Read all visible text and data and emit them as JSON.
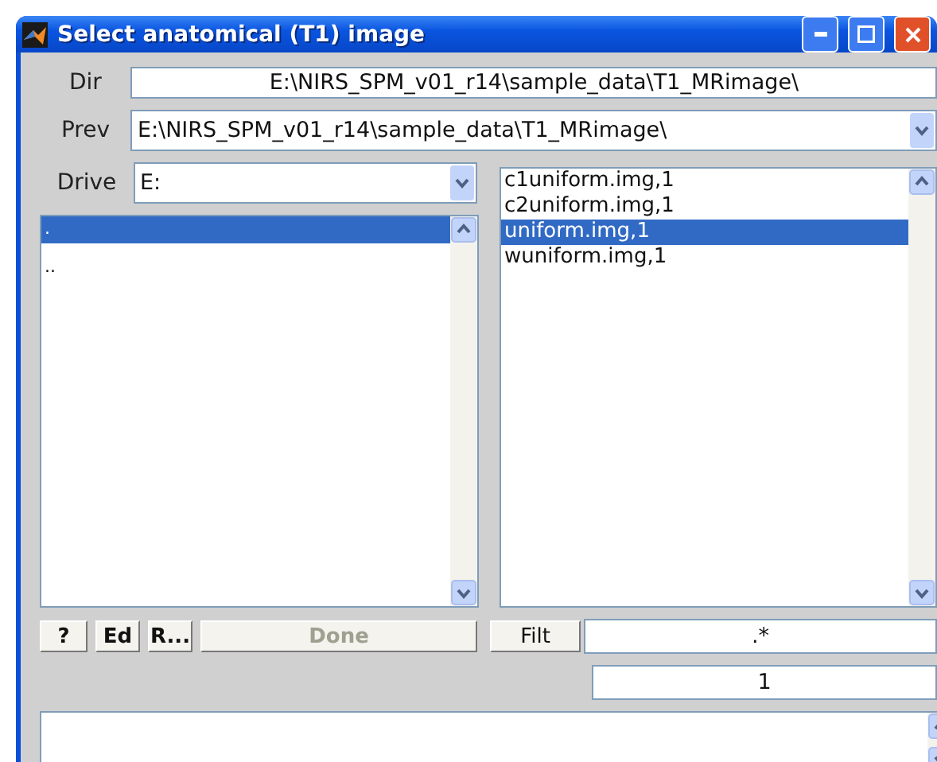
{
  "window": {
    "title": "Select anatomical (T1) image"
  },
  "dir": {
    "label": "Dir",
    "value": "E:\\NIRS_SPM_v01_r14\\sample_data\\T1_MRimage\\"
  },
  "prev": {
    "label": "Prev",
    "value": "E:\\NIRS_SPM_v01_r14\\sample_data\\T1_MRimage\\"
  },
  "drive": {
    "label": "Drive",
    "value": "E:"
  },
  "dir_list": [
    {
      "name": ".",
      "selected": true
    },
    {
      "name": "..",
      "selected": false
    }
  ],
  "file_list": [
    {
      "name": "c1uniform.img,1",
      "selected": false
    },
    {
      "name": "c2uniform.img,1",
      "selected": false
    },
    {
      "name": "uniform.img,1",
      "selected": true
    },
    {
      "name": "wuniform.img,1",
      "selected": false
    }
  ],
  "buttons": [
    {
      "label": "?",
      "disabled": false
    },
    {
      "label": "Ed",
      "disabled": false
    },
    {
      "label": "R...",
      "disabled": false
    },
    {
      "label": "Done",
      "disabled": true
    }
  ],
  "filter": {
    "button": "Filt",
    "value": ".*"
  },
  "count": {
    "value": "1"
  }
}
